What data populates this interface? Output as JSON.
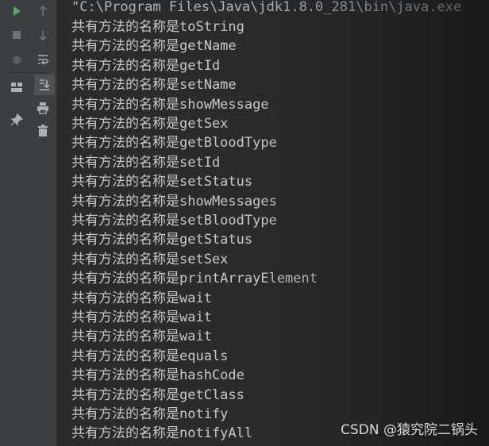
{
  "toolbar": {
    "tools": [
      {
        "icon": "run-icon"
      },
      {
        "icon": "up-arrow-icon"
      },
      {
        "icon": "stop-icon"
      },
      {
        "icon": "down-arrow-icon"
      },
      {
        "icon": "debug-bug-icon"
      },
      {
        "icon": "soft-wrap-icon"
      },
      {
        "icon": "layout-icon"
      },
      {
        "icon": "scroll-to-end-icon"
      },
      {
        "icon": "print-icon"
      },
      {
        "icon": "pin-icon"
      },
      {
        "icon": "trash-icon"
      }
    ],
    "colors": {
      "run": "#59a869",
      "icon": "#afb1b3"
    }
  },
  "console": {
    "command_line": "\"C:\\Program Files\\Java\\jdk1.8.0_281\\bin\\java.exe",
    "prefix": "共有方法的名称是",
    "methods": [
      "toString",
      "getName",
      "getId",
      "setName",
      "showMessage",
      "getSex",
      "getBloodType",
      "setId",
      "setStatus",
      "showMessages",
      "setBloodType",
      "getStatus",
      "setSex",
      "printArrayElement",
      "wait",
      "wait",
      "wait",
      "equals",
      "hashCode",
      "getClass",
      "notify",
      "notifyAll"
    ]
  },
  "watermark": "CSDN @猿究院二锅头"
}
